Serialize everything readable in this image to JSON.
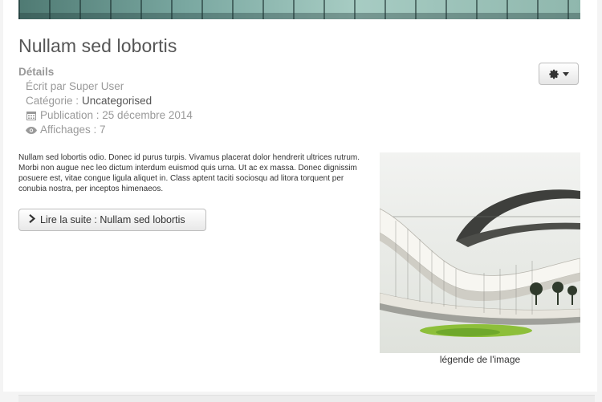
{
  "article": {
    "title": "Nullam sed lobortis",
    "details_heading": "Détails",
    "author": "Écrit par Super User",
    "category_label": "Catégorie : ",
    "category_value": "Uncategorised",
    "published": "Publication : 25 décembre 2014",
    "hits": "Affichages : 7",
    "body": "Nullam sed lobortis odio. Donec id purus turpis. Vivamus placerat dolor hendrerit ultrices rutrum. Morbi non augue nec leo dictum interdum euismod quis urna. Ut ac ex massa. Donec dignissim posuere est, vitae congue ligula aliquet in. Class aptent taciti sociosqu ad litora torquent per conubia nostra, per inceptos himenaeos.",
    "readmore_label": "Lire la suite : Nullam sed lobortis",
    "image_caption": "légende de l'image"
  },
  "icons": {
    "tools": "gear-icon",
    "tools_caret": "caret-down-icon",
    "published": "calendar-icon",
    "hits": "eye-icon",
    "readmore": "chevron-right-icon"
  }
}
